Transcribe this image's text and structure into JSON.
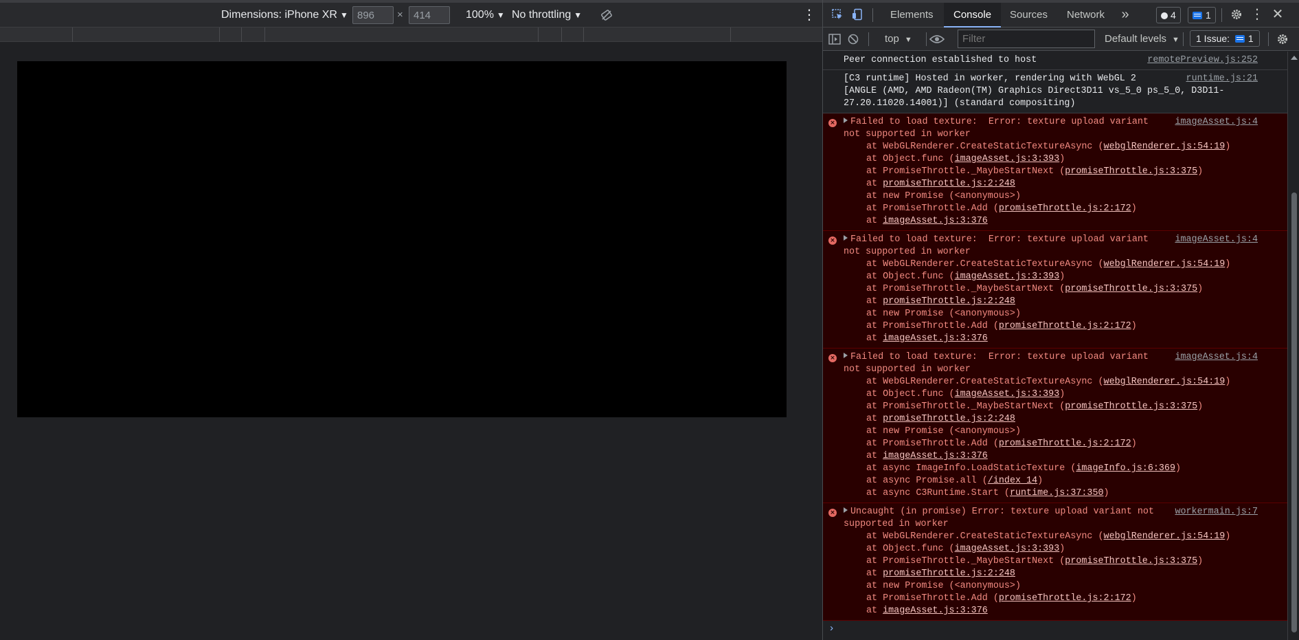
{
  "device_toolbar": {
    "dimensions_label": "Dimensions: iPhone XR",
    "width_value": "896",
    "times": "×",
    "height_value": "414",
    "zoom": "100%",
    "throttling": "No throttling",
    "more": "⋮"
  },
  "devtools": {
    "tabs": [
      "Elements",
      "Console",
      "Sources",
      "Network"
    ],
    "active_tab": "Console",
    "more_tabs": "»",
    "issues_count_badge": "4",
    "messages_badge": "1",
    "more": "⋮"
  },
  "console_toolbar": {
    "context": "top",
    "filter_placeholder": "Filter",
    "levels": "Default levels",
    "issues": "1 Issue:",
    "issues_count": "1"
  },
  "console": {
    "entries": [
      {
        "type": "info",
        "lines": [
          "Peer connection established to host"
        ],
        "source": "remotePreview.js:252"
      },
      {
        "type": "info",
        "lines": [
          "[C3 runtime] Hosted in worker, rendering with WebGL 2",
          "[ANGLE (AMD, AMD Radeon(TM) Graphics Direct3D11 vs_5_0 ps_5_0, D3D11-",
          "27.20.11020.14001)] (standard compositing)"
        ],
        "source": "runtime.js:21"
      },
      {
        "type": "error",
        "message": [
          "Failed to load texture:  Error: texture upload variant",
          "not supported in worker"
        ],
        "source": "imageAsset.js:4",
        "frames": [
          {
            "prefix": "at WebGLRenderer.CreateStaticTextureAsync (",
            "link": "webglRenderer.js:54:19",
            "suffix": ")"
          },
          {
            "prefix": "at Object.func (",
            "link": "imageAsset.js:3:393",
            "suffix": ")"
          },
          {
            "prefix": "at PromiseThrottle._MaybeStartNext (",
            "link": "promiseThrottle.js:3:375",
            "suffix": ")"
          },
          {
            "prefix": "at ",
            "link": "promiseThrottle.js:2:248",
            "suffix": ""
          },
          {
            "prefix": "at new Promise (<anonymous>)",
            "link": "",
            "suffix": ""
          },
          {
            "prefix": "at PromiseThrottle.Add (",
            "link": "promiseThrottle.js:2:172",
            "suffix": ")"
          },
          {
            "prefix": "at ",
            "link": "imageAsset.js:3:376",
            "suffix": ""
          }
        ]
      },
      {
        "type": "error",
        "message": [
          "Failed to load texture:  Error: texture upload variant",
          "not supported in worker"
        ],
        "source": "imageAsset.js:4",
        "frames": [
          {
            "prefix": "at WebGLRenderer.CreateStaticTextureAsync (",
            "link": "webglRenderer.js:54:19",
            "suffix": ")"
          },
          {
            "prefix": "at Object.func (",
            "link": "imageAsset.js:3:393",
            "suffix": ")"
          },
          {
            "prefix": "at PromiseThrottle._MaybeStartNext (",
            "link": "promiseThrottle.js:3:375",
            "suffix": ")"
          },
          {
            "prefix": "at ",
            "link": "promiseThrottle.js:2:248",
            "suffix": ""
          },
          {
            "prefix": "at new Promise (<anonymous>)",
            "link": "",
            "suffix": ""
          },
          {
            "prefix": "at PromiseThrottle.Add (",
            "link": "promiseThrottle.js:2:172",
            "suffix": ")"
          },
          {
            "prefix": "at ",
            "link": "imageAsset.js:3:376",
            "suffix": ""
          }
        ]
      },
      {
        "type": "error",
        "message": [
          "Failed to load texture:  Error: texture upload variant",
          "not supported in worker"
        ],
        "source": "imageAsset.js:4",
        "frames": [
          {
            "prefix": "at WebGLRenderer.CreateStaticTextureAsync (",
            "link": "webglRenderer.js:54:19",
            "suffix": ")"
          },
          {
            "prefix": "at Object.func (",
            "link": "imageAsset.js:3:393",
            "suffix": ")"
          },
          {
            "prefix": "at PromiseThrottle._MaybeStartNext (",
            "link": "promiseThrottle.js:3:375",
            "suffix": ")"
          },
          {
            "prefix": "at ",
            "link": "promiseThrottle.js:2:248",
            "suffix": ""
          },
          {
            "prefix": "at new Promise (<anonymous>)",
            "link": "",
            "suffix": ""
          },
          {
            "prefix": "at PromiseThrottle.Add (",
            "link": "promiseThrottle.js:2:172",
            "suffix": ")"
          },
          {
            "prefix": "at ",
            "link": "imageAsset.js:3:376",
            "suffix": ""
          },
          {
            "prefix": "at async ImageInfo.LoadStaticTexture (",
            "link": "imageInfo.js:6:369",
            "suffix": ")"
          },
          {
            "prefix": "at async Promise.all (",
            "link": "/index 14",
            "suffix": ")"
          },
          {
            "prefix": "at async C3Runtime.Start (",
            "link": "runtime.js:37:350",
            "suffix": ")"
          }
        ]
      },
      {
        "type": "error",
        "message": [
          "Uncaught (in promise) Error: texture upload variant not",
          "supported in worker"
        ],
        "source": "workermain.js:7",
        "frames": [
          {
            "prefix": "at WebGLRenderer.CreateStaticTextureAsync (",
            "link": "webglRenderer.js:54:19",
            "suffix": ")"
          },
          {
            "prefix": "at Object.func (",
            "link": "imageAsset.js:3:393",
            "suffix": ")"
          },
          {
            "prefix": "at PromiseThrottle._MaybeStartNext (",
            "link": "promiseThrottle.js:3:375",
            "suffix": ")"
          },
          {
            "prefix": "at ",
            "link": "promiseThrottle.js:2:248",
            "suffix": ""
          },
          {
            "prefix": "at new Promise (<anonymous>)",
            "link": "",
            "suffix": ""
          },
          {
            "prefix": "at PromiseThrottle.Add (",
            "link": "promiseThrottle.js:2:172",
            "suffix": ")"
          },
          {
            "prefix": "at ",
            "link": "imageAsset.js:3:376",
            "suffix": ""
          }
        ]
      }
    ],
    "prompt": "›"
  },
  "colors": {
    "error_bg": "#290000",
    "error_text": "#f28b82",
    "accent": "#8ab4f8"
  }
}
